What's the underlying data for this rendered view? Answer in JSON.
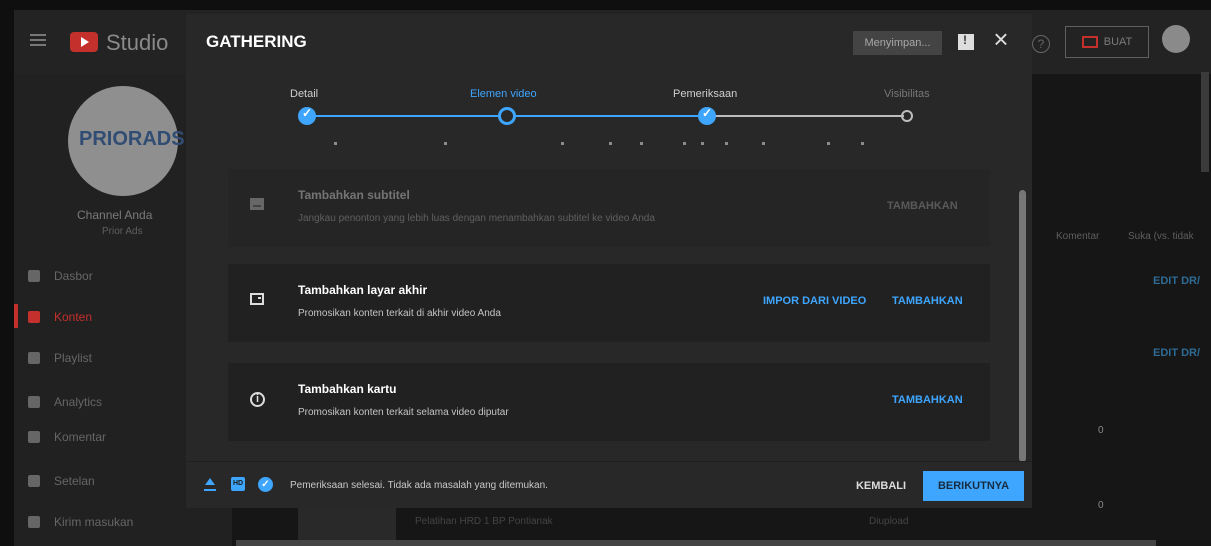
{
  "app": {
    "logo_text": "Studio",
    "top_actions": {
      "create_label": "BUAT"
    }
  },
  "sidebar": {
    "avatar_text": "PRIORADS",
    "channel_label": "Channel Anda",
    "channel_name": "Prior Ads",
    "items": [
      {
        "label": "Dasbor"
      },
      {
        "label": "Konten"
      },
      {
        "label": "Playlist"
      },
      {
        "label": "Analytics"
      },
      {
        "label": "Komentar"
      },
      {
        "label": "Setelan"
      },
      {
        "label": "Kirim masukan"
      }
    ]
  },
  "background": {
    "columns": [
      "Komentar",
      "Suka (vs. tidak"
    ],
    "row_links": [
      "EDIT DR/",
      "EDIT DR/"
    ],
    "counts": [
      "0",
      "0"
    ],
    "bottom_row_title": "Pelatihan HRD 1 BP Pontianak",
    "bottom_row_status": "Diupload"
  },
  "modal": {
    "title": "GATHERING",
    "saving_label": "Menyimpan...",
    "steps": [
      {
        "label": "Detail"
      },
      {
        "label": "Elemen video"
      },
      {
        "label": "Pemeriksaan"
      },
      {
        "label": "Visibilitas"
      }
    ],
    "cards": [
      {
        "title": "Tambahkan subtitel",
        "description": "Jangkau penonton yang lebih luas dengan menambahkan subtitel ke video Anda",
        "action": "TAMBAHKAN"
      },
      {
        "title": "Tambahkan layar akhir",
        "description": "Promosikan konten terkait di akhir video Anda",
        "secondary_action": "IMPOR DARI VIDEO",
        "action": "TAMBAHKAN"
      },
      {
        "title": "Tambahkan kartu",
        "description": "Promosikan konten terkait selama video diputar",
        "action": "TAMBAHKAN"
      }
    ],
    "footer": {
      "status_text": "Pemeriksaan selesai. Tidak ada masalah yang ditemukan.",
      "back_label": "KEMBALI",
      "next_label": "BERIKUTNYA"
    }
  },
  "colors": {
    "accent_blue": "#3ea6ff",
    "youtube_red": "#c4302b",
    "modal_bg": "#282828",
    "card_bg": "#212121"
  }
}
